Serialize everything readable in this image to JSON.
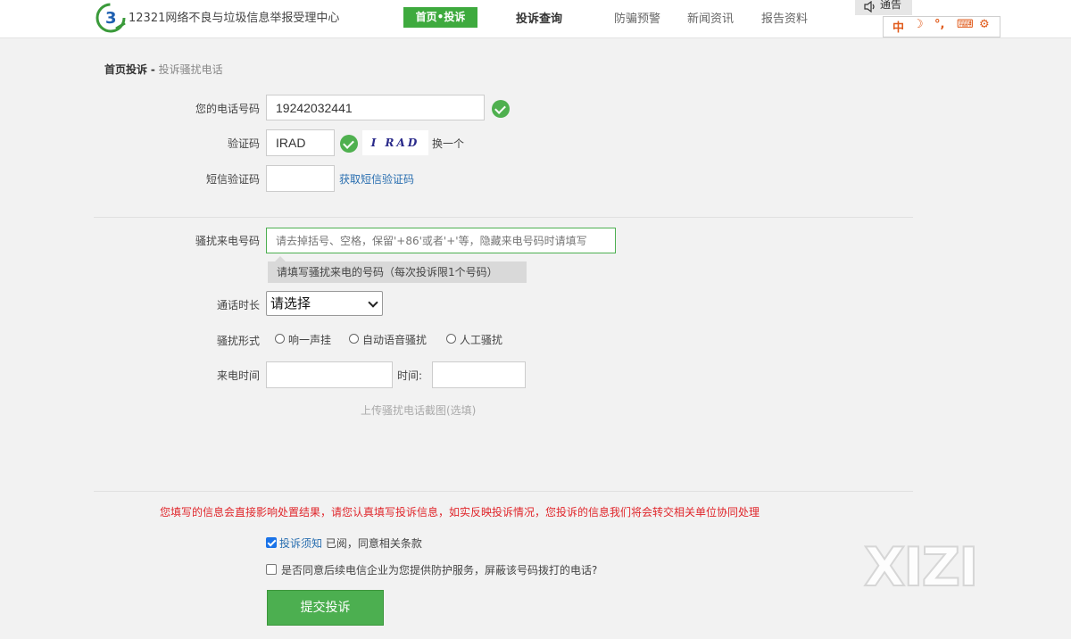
{
  "header": {
    "site_title": "12321网络不良与垃圾信息举报受理中心",
    "nav": {
      "home_report": "首页•投诉",
      "complaint_query": "投诉查询",
      "fraud_alert": "防骗预警",
      "news": "新闻资讯",
      "reports": "报告资料"
    },
    "notice_label": "通告",
    "ime_toolbar": [
      "中",
      "☽",
      "°,",
      "⌨",
      "⚙"
    ]
  },
  "breadcrumb": {
    "home": "首页投诉",
    "separator": "-",
    "current": "投诉骚扰电话"
  },
  "form": {
    "phone_label": "您的电话号码",
    "phone_value": "19242032441",
    "captcha_label": "验证码",
    "captcha_value": "IRAD",
    "captcha_image_text": "I RAD",
    "captcha_refresh": "换一个",
    "sms_label": "短信验证码",
    "sms_value": "",
    "sms_get_link": "获取短信验证码",
    "harass_label": "骚扰来电号码",
    "harass_placeholder": "请去掉括号、空格，保留'+86'或者'+'等，隐藏来电号码时请填写",
    "harass_hint": "请填写骚扰来电的号码（每次投诉限1个号码）",
    "duration_label": "通话时长",
    "duration_selected": "请选择",
    "type_label": "骚扰形式",
    "type_options": [
      "响一声挂",
      "自动语音骚扰",
      "人工骚扰"
    ],
    "call_time_label": "来电时间",
    "time_label": "时间:",
    "upload_link": "上传骚扰电话截图(选填)"
  },
  "footer": {
    "warning": "您填写的信息会直接影响处置结果，请您认真填写投诉信息，如实反映投诉情况，您投诉的信息我们将会转交相关单位协同处理",
    "agree_link": "投诉须知",
    "agree_text": "已阅，同意相关条款",
    "agree_checked": true,
    "protect_text": "是否同意后续电信企业为您提供防护服务，屏蔽该号码拨打的电话?",
    "protect_checked": false,
    "submit_label": "提交投诉"
  },
  "watermark": "XIZI",
  "colors": {
    "accent_green": "#3eaa3e",
    "warning_red": "#e0262b",
    "link_blue": "#2a6fb0"
  }
}
